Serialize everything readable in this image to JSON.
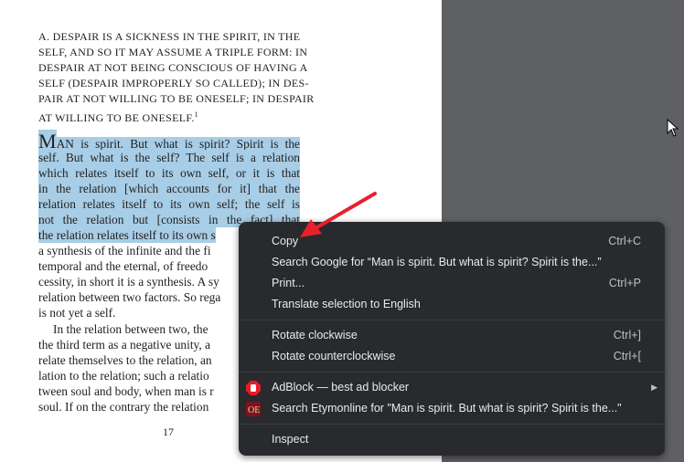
{
  "document": {
    "heading_lines": [
      "A. DESPAIR IS A SICKNESS IN THE SPIRIT, IN THE",
      "SELF, AND SO IT MAY ASSUME A TRIPLE FORM: IN",
      "DESPAIR AT NOT BEING CONSCIOUS OF HAVING A",
      "SELF (DESPAIR IMPROPERLY SO CALLED); IN DES-",
      "PAIR AT NOT WILLING TO BE ONESELF; IN DESPAIR",
      "AT WILLING TO BE ONESELF."
    ],
    "footnote_mark": "1",
    "drop_cap": "M",
    "selected_lines": [
      "AN is spirit. But what is spirit? Spirit is the",
      "self. But what is the self? The self is a relation",
      "which relates itself to its own self, or it is that",
      "in the relation [which accounts for it] that the",
      "relation relates itself to its own self; the self is",
      "not the relation but [consists in the fact] that",
      "the relation relates itself to its own s"
    ],
    "body_lines": [
      "a synthesis of the infinite and the fi",
      "temporal and the eternal, of freedo",
      "cessity, in short it is a synthesis. A sy",
      "relation between two factors. So rega",
      "is not yet a self."
    ],
    "body_lines_2": [
      "In the relation between two, the",
      "the third term as a negative unity, a",
      "relate themselves to the relation, an",
      "lation to the relation; such a relatio",
      "tween soul and body, when man is r",
      "soul. If on the contrary the relation"
    ],
    "page_number": "17"
  },
  "context_menu": {
    "items": [
      {
        "label": "Copy",
        "shortcut": "Ctrl+C"
      },
      {
        "label": "Search Google for “Man is spirit. But what is spirit? Spirit is the...”",
        "shortcut": ""
      },
      {
        "label": "Print...",
        "shortcut": "Ctrl+P"
      },
      {
        "label": "Translate selection to English",
        "shortcut": ""
      },
      {
        "label": "Rotate clockwise",
        "shortcut": "Ctrl+]"
      },
      {
        "label": "Rotate counterclockwise",
        "shortcut": "Ctrl+["
      },
      {
        "label": "AdBlock — best ad blocker",
        "shortcut": "",
        "icon": "adblock-hand-icon",
        "submenu": true
      },
      {
        "label": "Search Etymonline for \"Man is spirit. But what is spirit? Spirit is the...\"",
        "shortcut": "",
        "icon": "etymonline-icon"
      },
      {
        "label": "Inspect",
        "shortcut": ""
      }
    ]
  },
  "colors": {
    "selection": "#a8cde6",
    "menu_bg": "#292a2d",
    "viewer_bg": "#5f6063",
    "arrow": "#e8202a"
  }
}
